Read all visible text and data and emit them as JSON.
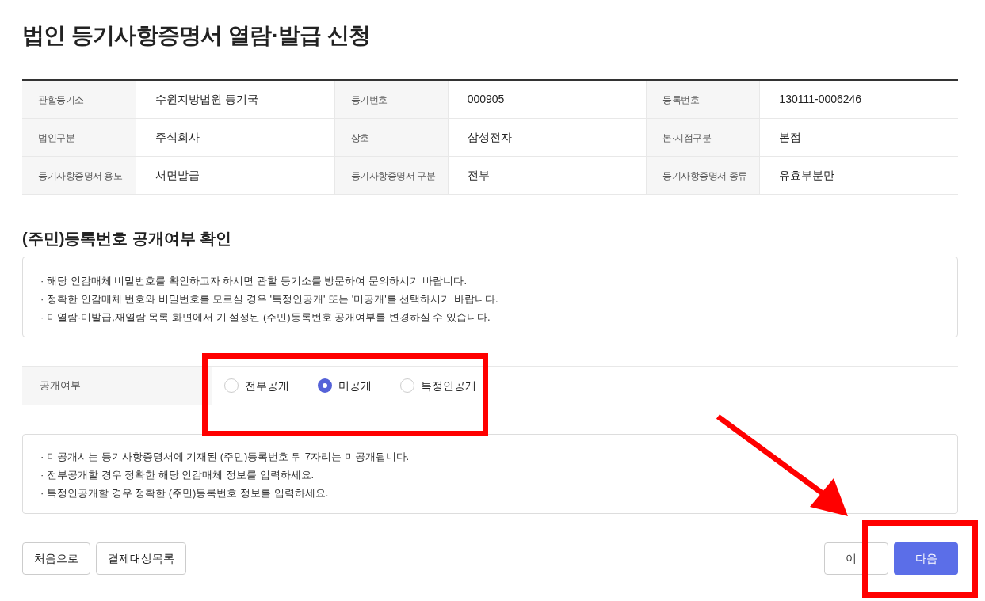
{
  "title": "법인 등기사항증명서 열람·발급 신청",
  "info_table": [
    [
      {
        "label": "관할등기소",
        "value": "수원지방법원 등기국"
      },
      {
        "label": "등기번호",
        "value": "000905"
      },
      {
        "label": "등록번호",
        "value": "130111-0006246"
      }
    ],
    [
      {
        "label": "법인구분",
        "value": "주식회사"
      },
      {
        "label": "상호",
        "value": "삼성전자"
      },
      {
        "label": "본·지점구분",
        "value": "본점"
      }
    ],
    [
      {
        "label": "등기사항증명서 용도",
        "value": "서면발급"
      },
      {
        "label": "등기사항증명서 구분",
        "value": "전부"
      },
      {
        "label": "등기사항증명서 종류",
        "value": "유효부분만"
      }
    ]
  ],
  "section_title": "(주민)등록번호 공개여부 확인",
  "notice_1": [
    "· 해당 인감매체 비밀번호를 확인하고자 하시면 관할 등기소를 방문하여 문의하시기 바랍니다.",
    "· 정확한 인감매체 번호와 비밀번호를 모르실 경우 '특정인공개' 또는 '미공개'를 선택하시기 바랍니다.",
    "· 미열람·미발급,재열람 목록 화면에서 기 설정된 (주민)등록번호 공개여부를 변경하실 수 있습니다."
  ],
  "disclosure": {
    "label": "공개여부",
    "options": [
      {
        "label": "전부공개",
        "selected": false
      },
      {
        "label": "미공개",
        "selected": true
      },
      {
        "label": "특정인공개",
        "selected": false
      }
    ]
  },
  "notice_2": [
    "· 미공개시는 등기사항증명서에 기재된 (주민)등록번호 뒤 7자리는 미공개됩니다.",
    "· 전부공개할 경우 정확한 해당 인감매체 정보를 입력하세요.",
    "· 특정인공개할 경우 정확한 (주민)등록번호 정보를 입력하세요."
  ],
  "left_buttons": [
    "처음으로",
    "결제대상목록"
  ],
  "prev_button": "이",
  "next_button": "다음"
}
